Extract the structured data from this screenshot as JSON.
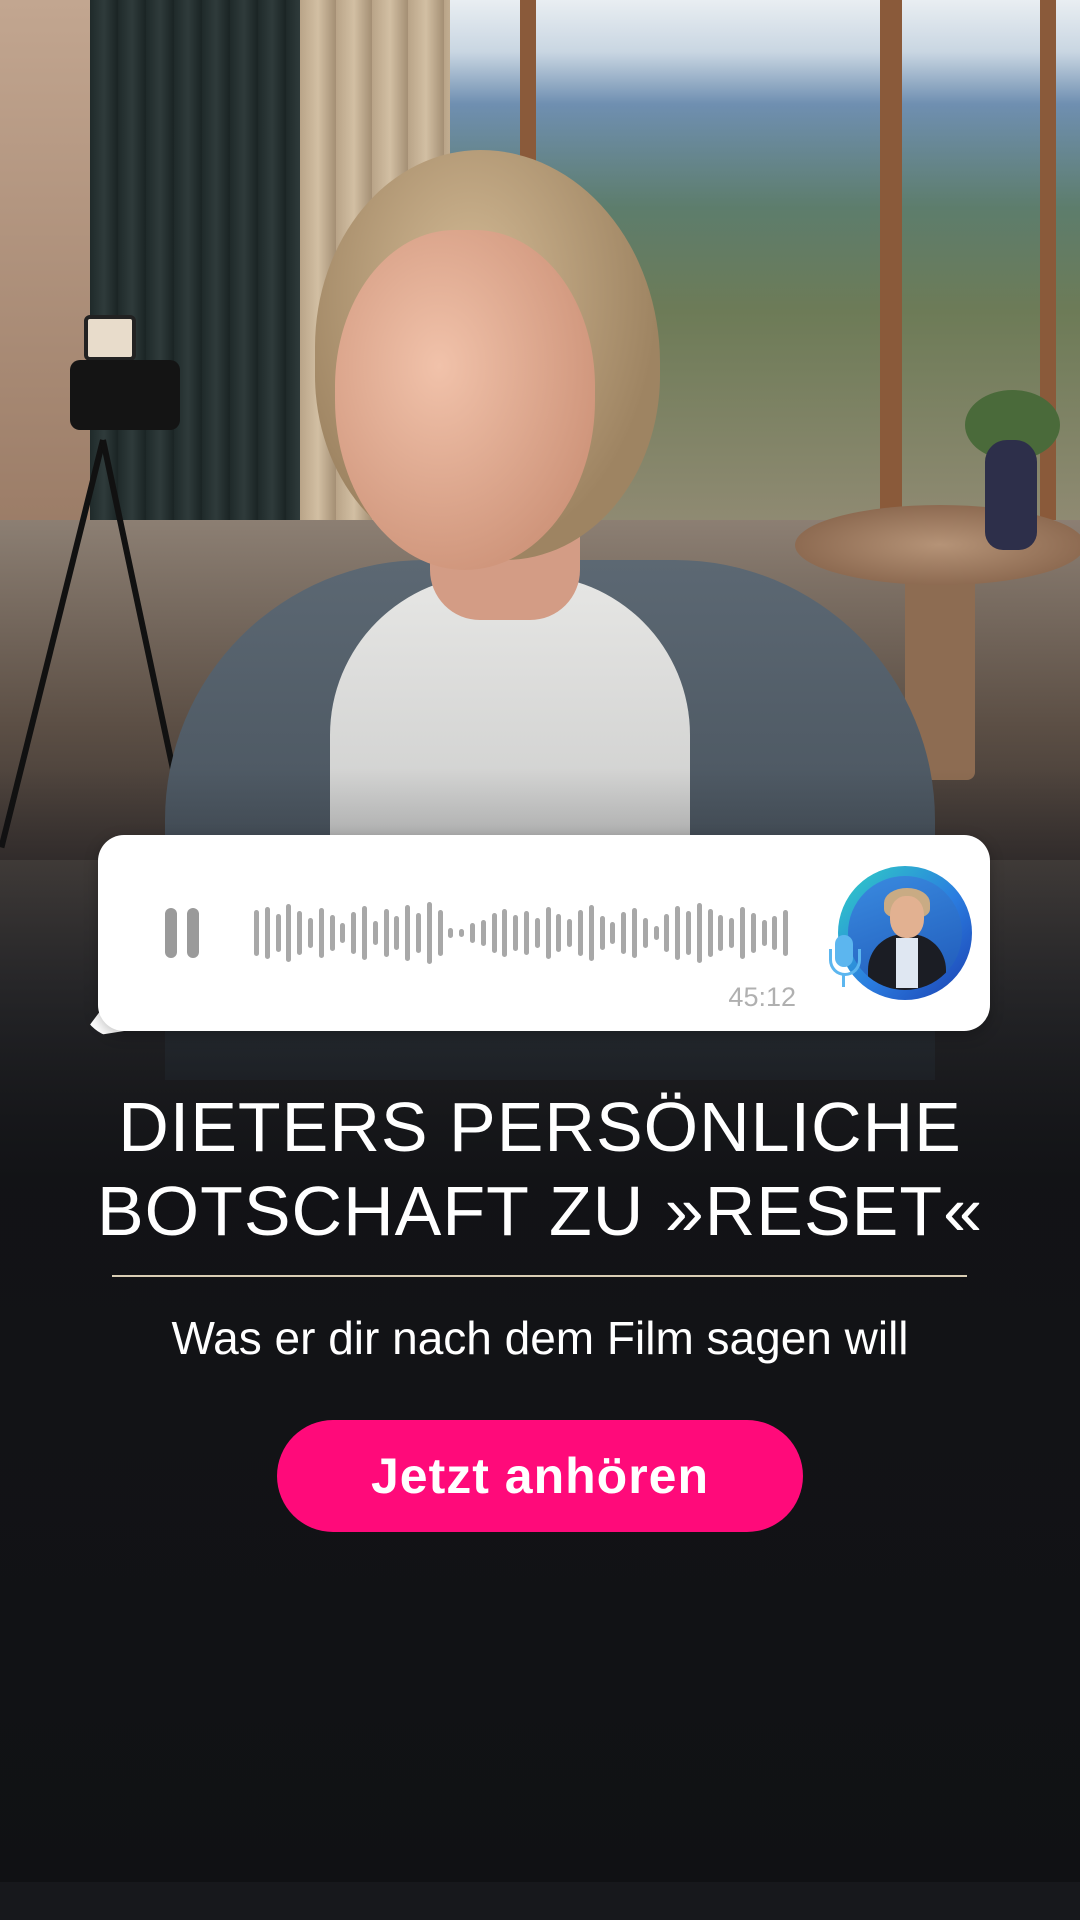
{
  "audio_player": {
    "duration": "45:12",
    "state": "playing",
    "icons": {
      "control": "pause-icon",
      "microphone": "microphone-icon"
    }
  },
  "promo": {
    "headline_line1": "DIETERS PERSÖNLICHE",
    "headline_line2": "BOTSCHAFT ZU »RESET«",
    "subtitle": "Was er dir nach dem Film sagen will",
    "cta_label": "Jetzt anhören"
  },
  "colors": {
    "accent": "#ff0a7a",
    "background": "#121316",
    "divider": "#d9cdb4",
    "waveform": "#a8a8a8",
    "avatar_ring": "#2b7de0"
  }
}
